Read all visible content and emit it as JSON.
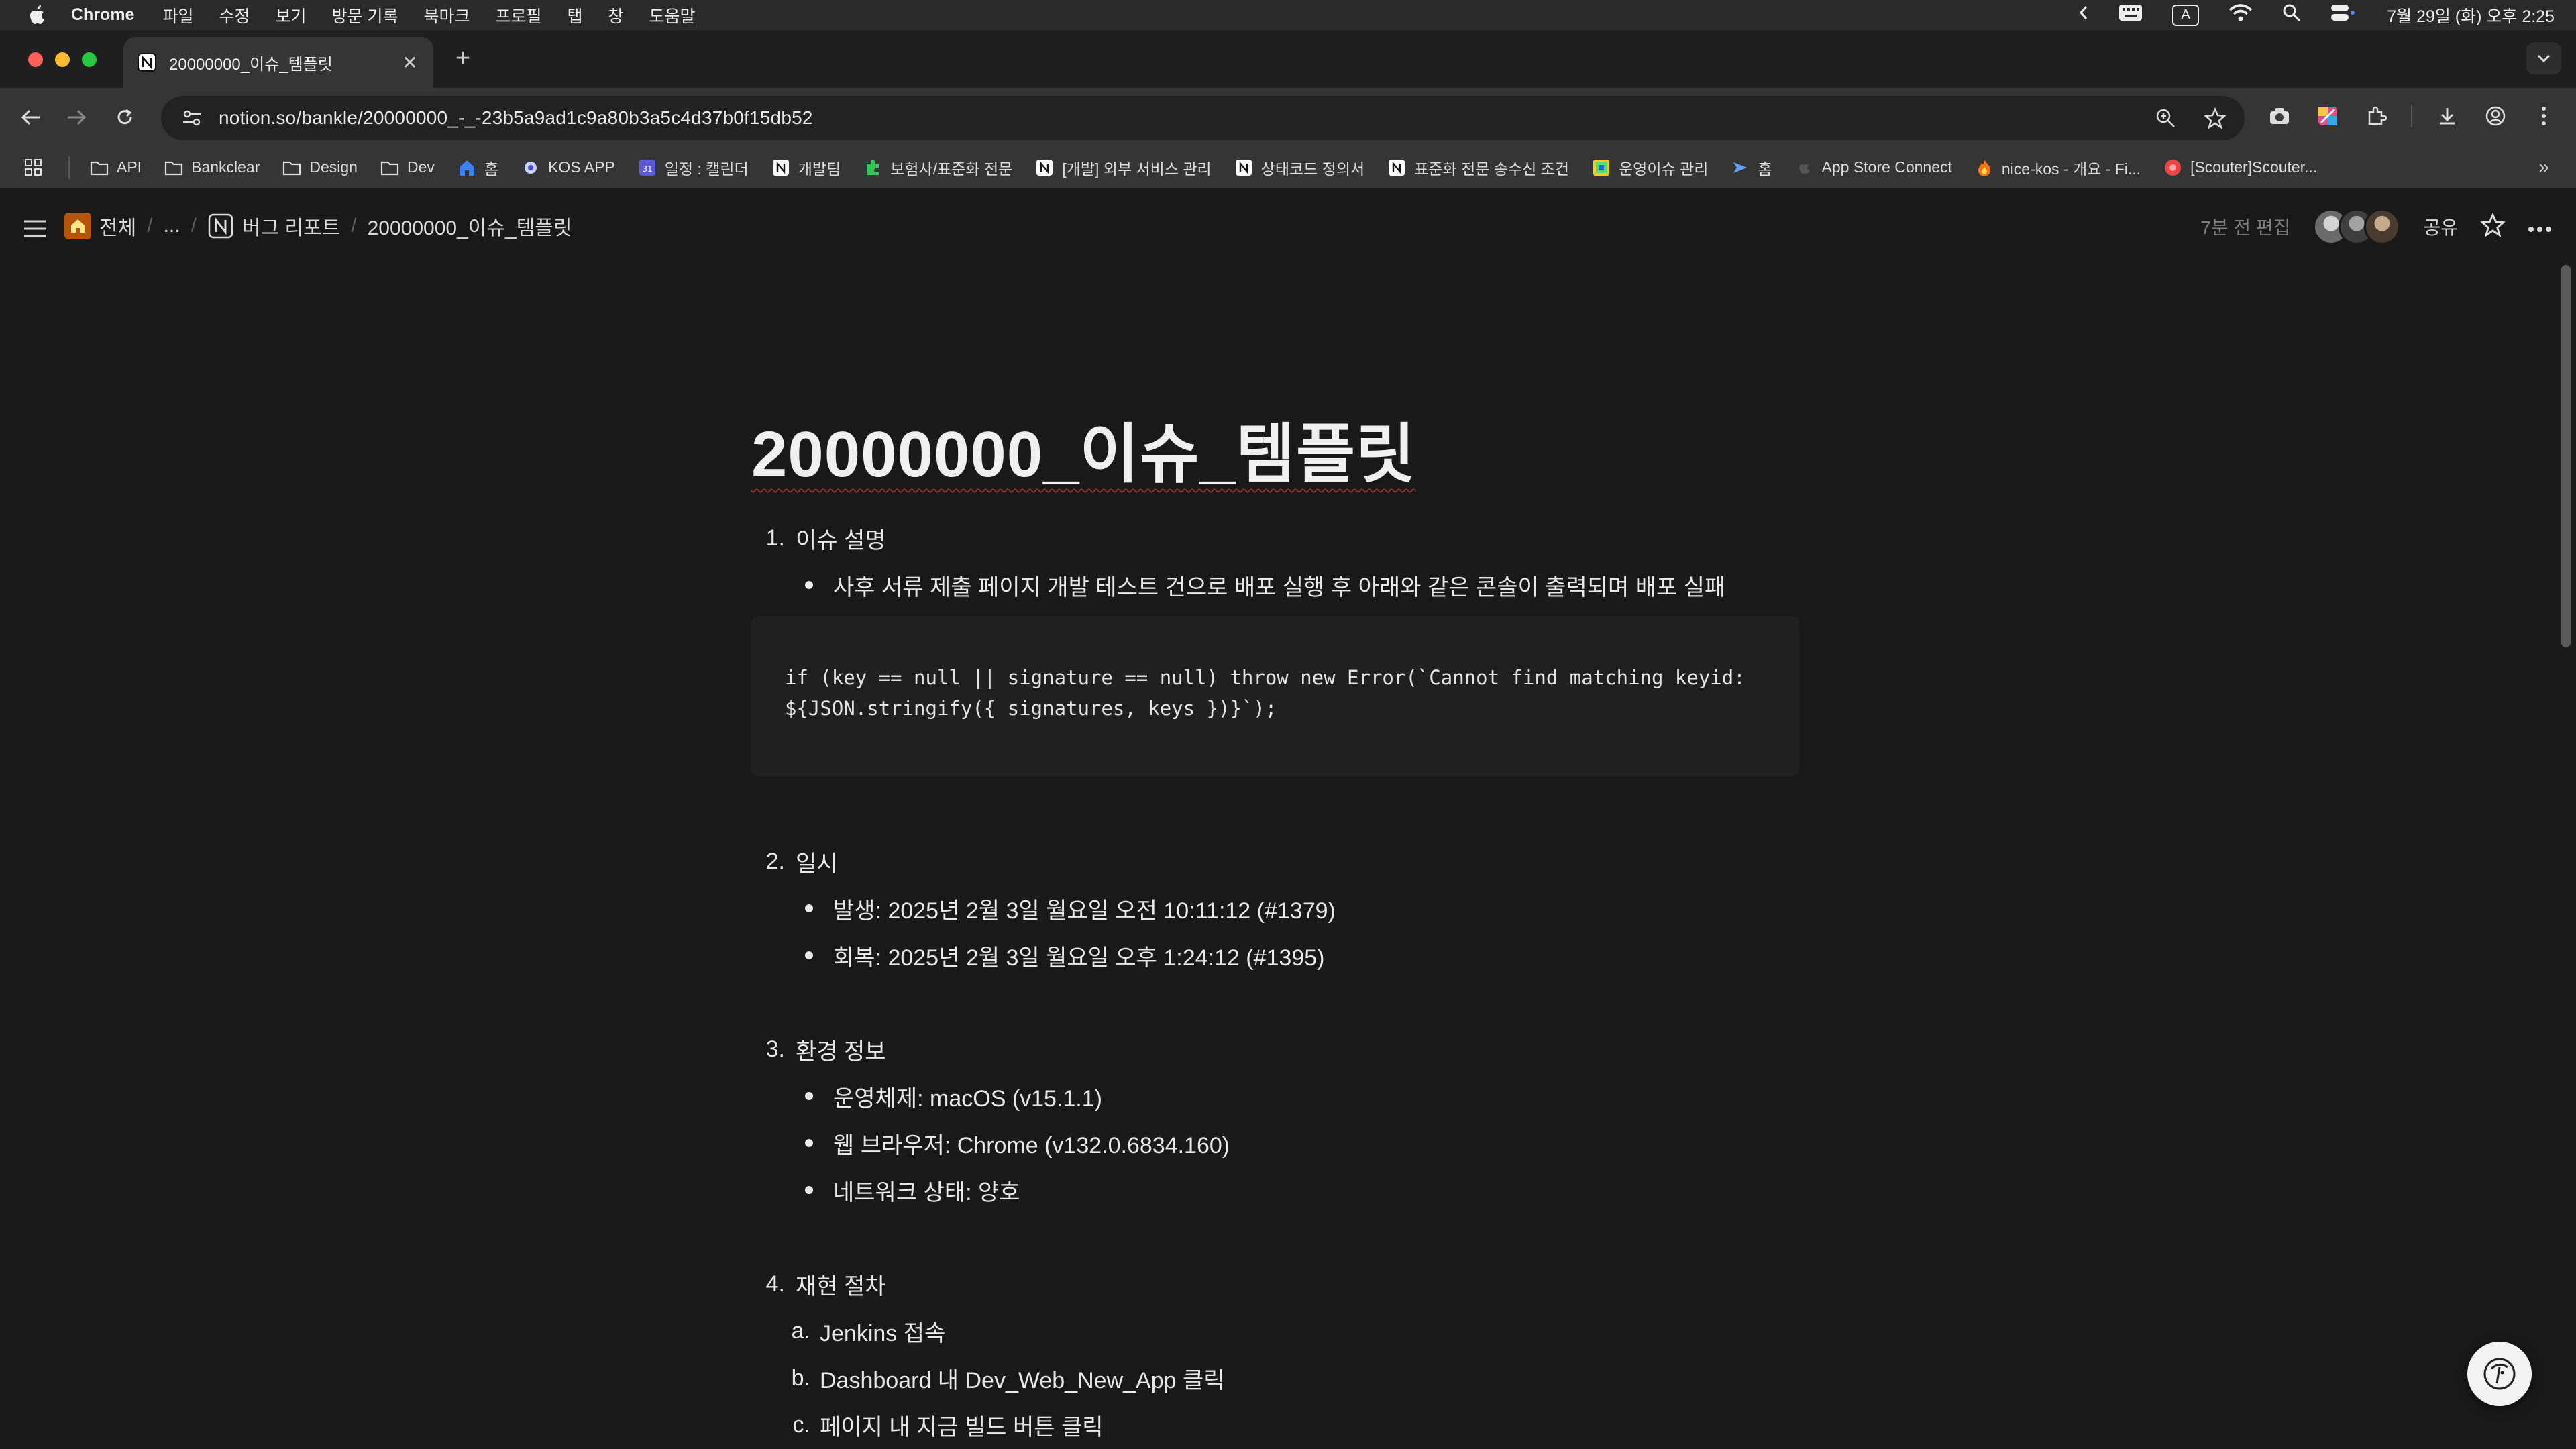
{
  "menubar": {
    "app_name": "Chrome",
    "items": [
      "파일",
      "수정",
      "보기",
      "방문 기록",
      "북마크",
      "프로필",
      "탭",
      "창",
      "도움말"
    ],
    "clock": "7월 29일 (화) 오후 2:25",
    "status_icons": [
      "chevron-left-icon",
      "keyboard-icon",
      "input-source-a-icon",
      "wifi-icon",
      "spotlight-search-icon",
      "control-center-icon"
    ],
    "input_source_label": "A"
  },
  "tab": {
    "title": "20000000_이슈_템플릿",
    "favicon": "notion-icon"
  },
  "toolbar": {
    "url": "notion.so/bankle/20000000_-_-23b5a9ad1c9a80b3a5c4d37b0f15db52"
  },
  "bookmarks": [
    {
      "label": "API",
      "icon": "folder-icon"
    },
    {
      "label": "Bankclear",
      "icon": "folder-icon"
    },
    {
      "label": "Design",
      "icon": "folder-icon"
    },
    {
      "label": "Dev",
      "icon": "folder-icon"
    },
    {
      "label": "홈",
      "icon": "home-icon"
    },
    {
      "label": "KOS APP",
      "icon": "kos-icon"
    },
    {
      "label": "일정 : 캘린더",
      "icon": "calendar-icon"
    },
    {
      "label": "개발팀",
      "icon": "notion-icon"
    },
    {
      "label": "보험사/표준화 전문",
      "icon": "puzzle-icon"
    },
    {
      "label": "[개발] 외부 서비스 관리",
      "icon": "notion-icon"
    },
    {
      "label": "상태코드 정의서",
      "icon": "notion-icon"
    },
    {
      "label": "표준화 전문 송수신 조건",
      "icon": "notion-icon"
    },
    {
      "label": "운영이슈 관리",
      "icon": "sheet-icon"
    },
    {
      "label": "홈",
      "icon": "arrow-icon"
    },
    {
      "label": "App Store Connect",
      "icon": "apple-icon"
    },
    {
      "label": "nice-kos - 개요 - Fi...",
      "icon": "flame-icon"
    },
    {
      "label": "[Scouter]Scouter...",
      "icon": "scouter-icon"
    }
  ],
  "notion": {
    "breadcrumb": {
      "workspace": "전체",
      "ellipsis": "...",
      "parent": "버그 리포트",
      "current": "20000000_이슈_템플릿"
    },
    "edited": "7분 전 편집",
    "share": "공유"
  },
  "doc": {
    "title": "20000000_이슈_템플릿",
    "sections": [
      {
        "num": "1.",
        "heading": "이슈 설명",
        "bullets": [
          "사후 서류 제출 페이지 개발 테스트 건으로 배포 실행 후 아래와 같은 콘솔이 출력되며 배포 실패"
        ],
        "code": "if (key == null || signature == null) throw new Error(`Cannot find matching keyid: ${JSON.stringify({ signatures, keys })}`);"
      },
      {
        "num": "2.",
        "heading": "일시",
        "bullets": [
          "발생: 2025년 2월 3일 월요일 오전 10:11:12 (#1379)",
          "회복: 2025년 2월 3일 월요일 오후 1:24:12 (#1395)"
        ]
      },
      {
        "num": "3.",
        "heading": "환경 정보",
        "bullets": [
          "운영체제: macOS (v15.1.1)",
          "웹 브라우저: Chrome (v132.0.6834.160)",
          "네트워크 상태: 양호"
        ]
      },
      {
        "num": "4.",
        "heading": "재현 절차",
        "steps": [
          {
            "num": "a.",
            "text": "Jenkins 접속"
          },
          {
            "num": "b.",
            "text": "Dashboard 내 Dev_Web_New_App 클릭"
          },
          {
            "num": "c.",
            "text": "페이지 내 지금 빌드 버튼 클릭"
          }
        ]
      }
    ]
  },
  "colors": {
    "background": "#191919",
    "chrome_toolbar": "#353535",
    "code_bg": "#202020"
  }
}
